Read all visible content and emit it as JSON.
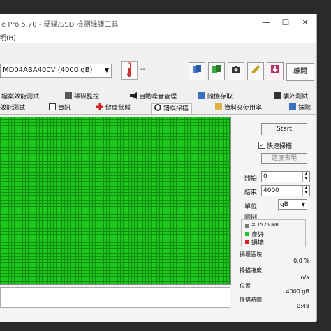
{
  "window": {
    "title": "e Pro 5.70 - 硬碟/SSD 檢測維護工具",
    "minimize_label": "—",
    "maximize_label": "☐",
    "close_label": "✕"
  },
  "menu": {
    "help": "明(H)"
  },
  "toolbar": {
    "drive": "MD04ABA400V (4000 gB)",
    "temperature": "--",
    "exit_label": "離開"
  },
  "tabs_row1": [
    {
      "label": "檔案效能測試"
    },
    {
      "label": "磁碟監控"
    },
    {
      "label": "自動噪音管理"
    },
    {
      "label": "隨機存取"
    },
    {
      "label": "額外測試"
    }
  ],
  "tabs_row2": [
    {
      "label": "效能測試"
    },
    {
      "label": "資訊"
    },
    {
      "label": "健康狀態"
    },
    {
      "label": "錯誤掃描",
      "active": true
    },
    {
      "label": "資料夾使用率"
    },
    {
      "label": "抹除"
    }
  ],
  "scan": {
    "start_label": "Start",
    "quick_scan_label": "快速掃描",
    "quick_scan_checked": true,
    "goto_label": "進度表現",
    "start_field_label": "開始",
    "start_value": "0",
    "end_field_label": "結束",
    "end_value": "4000",
    "unit_label": "單位",
    "unit_value": "gB",
    "legend_title": "圖例",
    "legend_block": "= 1526 MB",
    "legend_ok": "良好",
    "legend_bad": "損壞",
    "damaged_blocks_label": "損壞區塊",
    "damaged_blocks_value": "0.0 %",
    "scan_speed_label": "掃描速度",
    "scan_speed_value": "n/a",
    "position_label": "位置",
    "position_value": "4000 gB",
    "elapsed_label": "掃描時間",
    "elapsed_value": "0:48"
  },
  "colors": {
    "grid_ok": "#1ec81e",
    "grid_line": "#0d8f0d",
    "legend_bad": "#d02020"
  }
}
